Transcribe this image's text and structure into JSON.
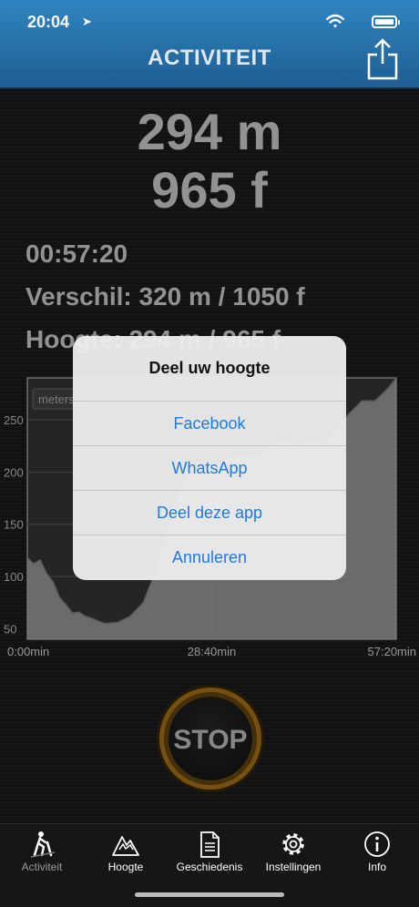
{
  "status": {
    "time": "20:04"
  },
  "header": {
    "title": "ACTIVITEIT"
  },
  "stats": {
    "meters": "294 m",
    "feet": "965 f",
    "duration": "00:57:20",
    "difference": "Verschil: 320 m / 1050 f",
    "altitude": "Hoogte: 294 m / 965 f"
  },
  "chart_data": {
    "type": "area",
    "legend": "meters",
    "y_ticks": [
      "250",
      "200",
      "150",
      "100",
      "50"
    ],
    "x_ticks": [
      "0:00min",
      "28:40min",
      "57:20min"
    ],
    "ylim": [
      40,
      290
    ],
    "x_minutes": [
      0,
      1,
      2,
      3,
      4,
      5,
      6,
      7,
      8,
      9,
      10,
      12,
      14,
      16,
      18,
      20,
      22,
      24,
      26,
      28,
      30,
      32,
      34,
      36,
      38,
      40,
      42,
      44,
      46,
      48,
      50,
      52,
      54,
      56,
      57.3
    ],
    "values": [
      118,
      112,
      116,
      103,
      95,
      80,
      73,
      65,
      66,
      62,
      60,
      55,
      56,
      62,
      75,
      106,
      150,
      190,
      205,
      205,
      210,
      215,
      215,
      216,
      225,
      230,
      225,
      232,
      225,
      240,
      256,
      268,
      268,
      280,
      290
    ]
  },
  "dialog": {
    "title": "Deel uw hoogte",
    "buttons": [
      "Facebook",
      "WhatsApp",
      "Deel deze app",
      "Annuleren"
    ]
  },
  "stop_label": "STOP",
  "tabs": [
    {
      "label": "Activiteit",
      "icon": "hiker-icon"
    },
    {
      "label": "Hoogte",
      "icon": "mountain-icon"
    },
    {
      "label": "Geschiedenis",
      "icon": "document-icon"
    },
    {
      "label": "Instellingen",
      "icon": "gear-icon"
    },
    {
      "label": "Info",
      "icon": "info-icon"
    }
  ],
  "colors": {
    "accent": "#1f7ae0",
    "header": "#2a78b3",
    "stop_ring": "#c68a1e"
  }
}
